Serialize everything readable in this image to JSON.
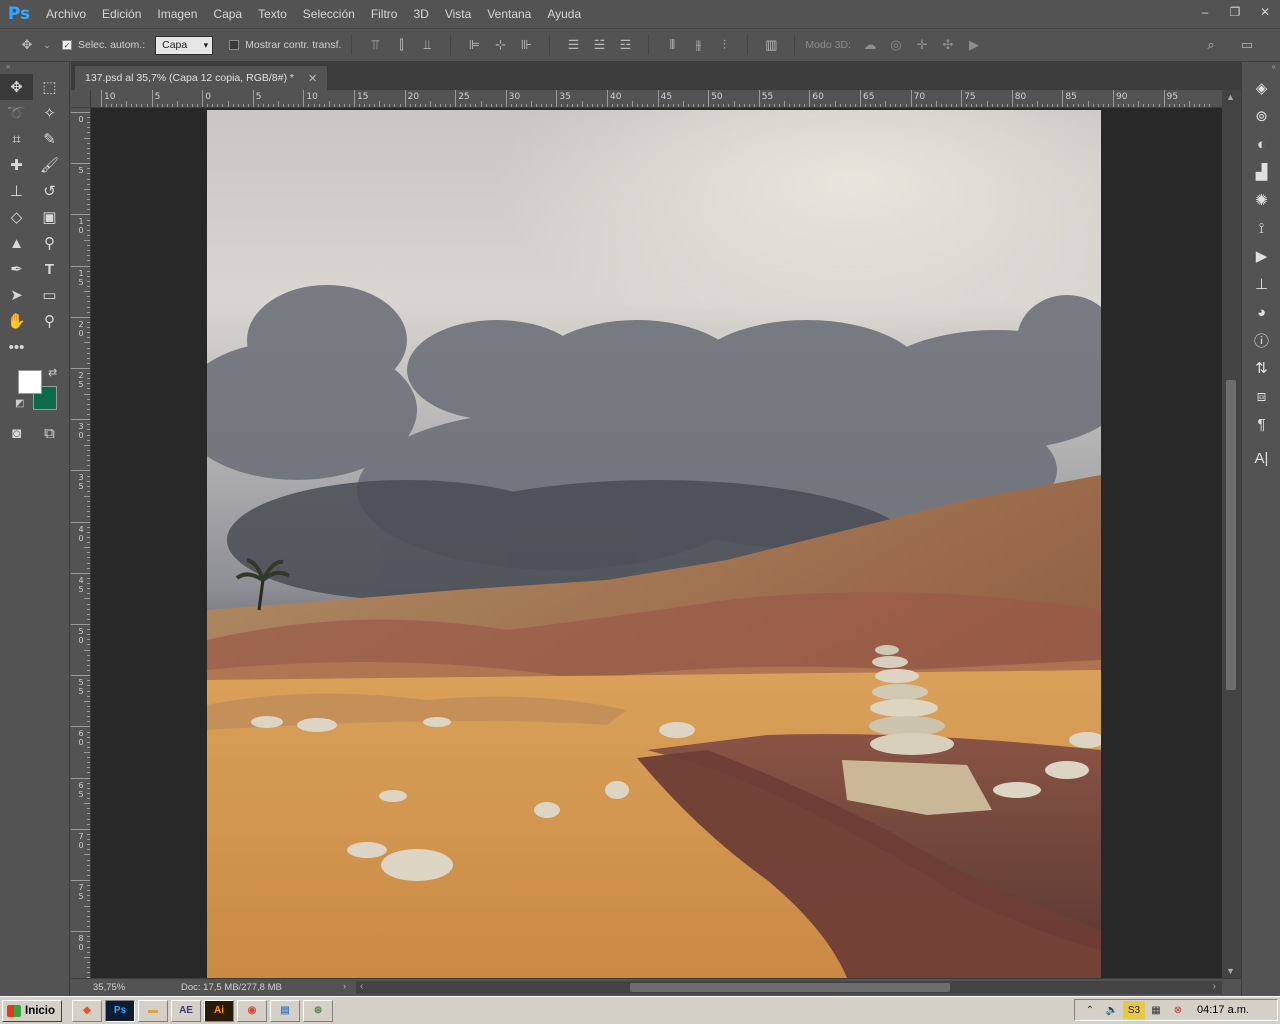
{
  "app": {
    "logo": "Ps",
    "menu": [
      "Archivo",
      "Edición",
      "Imagen",
      "Capa",
      "Texto",
      "Selección",
      "Filtro",
      "3D",
      "Vista",
      "Ventana",
      "Ayuda"
    ],
    "window_controls": [
      "–",
      "❐",
      "✕"
    ]
  },
  "options": {
    "auto_select_label": "Selec. autom.:",
    "auto_select_checked": true,
    "target_select": "Capa",
    "show_transform_label": "Mostrar contr. transf.",
    "mode_3d_label": "Modo 3D:"
  },
  "document": {
    "tab_title": "137.psd al 35,7% (Capa 12 copia, RGB/8#) *",
    "zoom": "35,75%",
    "doc_info": "Doc: 17,5 MB/277,8 MB"
  },
  "rulers": {
    "horizontal": [
      "10",
      "5",
      "0",
      "5",
      "10",
      "15",
      "20",
      "25",
      "30",
      "35",
      "40",
      "45",
      "50",
      "55",
      "60",
      "65",
      "70",
      "75",
      "80",
      "85",
      "90",
      "95"
    ],
    "vertical": [
      "0",
      "5",
      "10",
      "15",
      "20",
      "25",
      "30",
      "35",
      "40",
      "45",
      "50",
      "55",
      "60",
      "65",
      "70",
      "75",
      "80",
      "8"
    ]
  },
  "colors": {
    "foreground": "#ffffff",
    "background": "#0b6b4a",
    "ps_blue": "#31a8ff"
  },
  "taskbar": {
    "start_label": "Inicio",
    "apps": [
      "brave",
      "Ps",
      "explorer",
      "AE",
      "Ai",
      "chrome",
      "notepad",
      "app"
    ],
    "clock": "04:17 a.m."
  }
}
